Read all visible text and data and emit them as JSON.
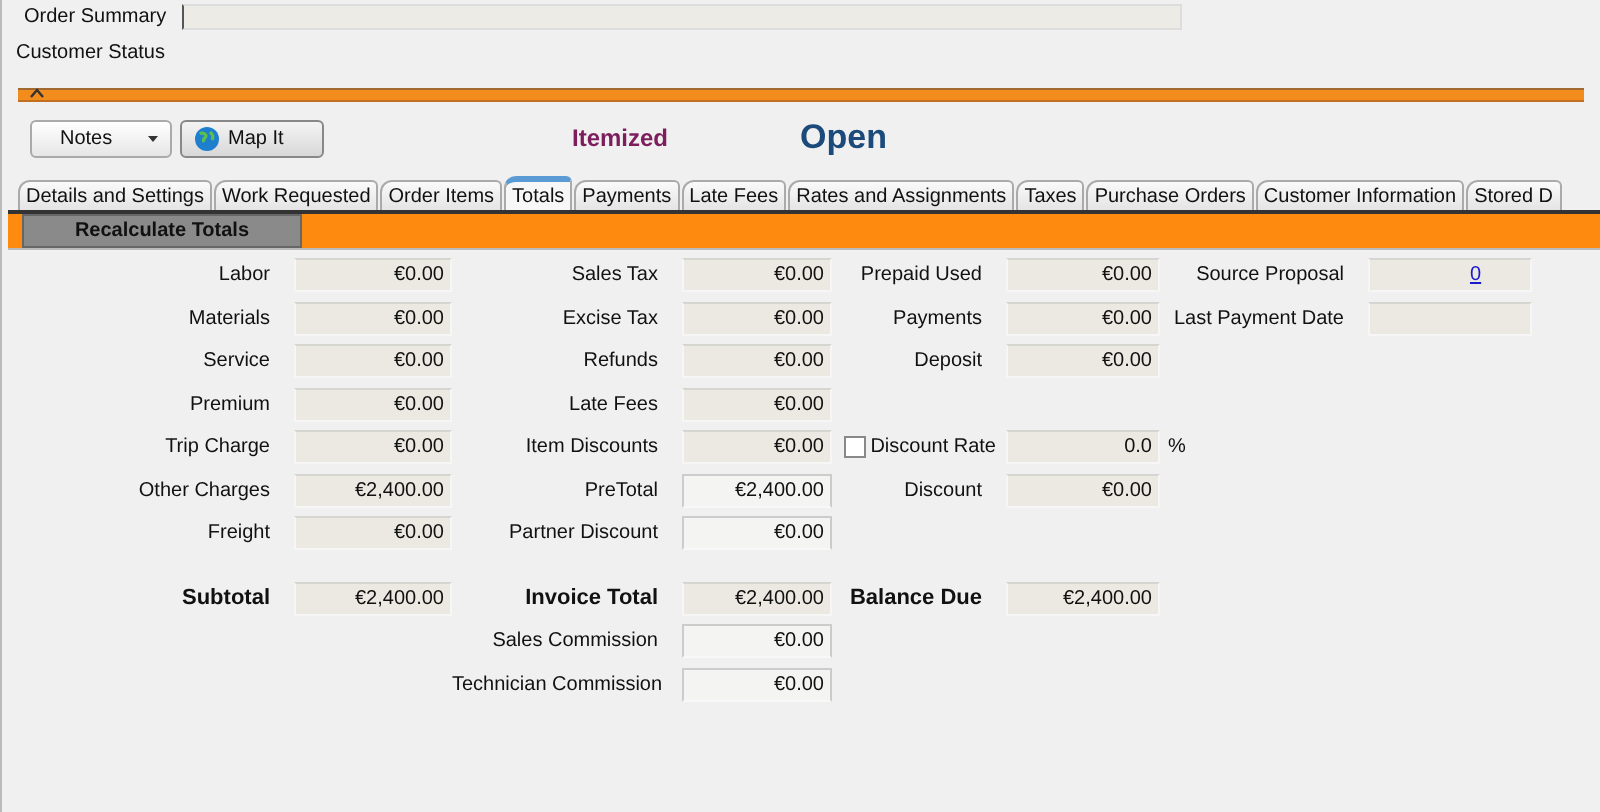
{
  "header": {
    "order_summary": {
      "label": "Order Summary"
    },
    "customer_status": {
      "label": "Customer Status"
    }
  },
  "toolbar": {
    "notes_button": "Notes",
    "map_button": "Map It",
    "billing_mode": "Itemized",
    "status": "Open"
  },
  "tabs": [
    {
      "label": "Details and Settings",
      "selected": false
    },
    {
      "label": "Work Requested",
      "selected": false
    },
    {
      "label": "Order Items",
      "selected": false
    },
    {
      "label": "Totals",
      "selected": true
    },
    {
      "label": "Payments",
      "selected": false
    },
    {
      "label": "Late Fees",
      "selected": false
    },
    {
      "label": "Rates and Assignments",
      "selected": false
    },
    {
      "label": "Taxes",
      "selected": false
    },
    {
      "label": "Purchase Orders",
      "selected": false
    },
    {
      "label": "Customer Information",
      "selected": false
    },
    {
      "label": "Stored D",
      "selected": false
    }
  ],
  "recalculate_button": "Recalculate Totals",
  "columns": [
    [
      {
        "label": "Labor",
        "value": "€0.00",
        "kind": "readonly"
      },
      {
        "label": "Materials",
        "value": "€0.00",
        "kind": "readonly"
      },
      {
        "label": "Service",
        "value": "€0.00",
        "kind": "readonly"
      },
      {
        "label": "Premium",
        "value": "€0.00",
        "kind": "readonly"
      },
      {
        "label": "Trip Charge",
        "value": "€0.00",
        "kind": "readonly"
      },
      {
        "label": "Other Charges",
        "value": "€2,400.00",
        "kind": "readonly"
      },
      {
        "label": "Freight",
        "value": "€0.00",
        "kind": "readonly"
      },
      {
        "label": "Subtotal",
        "value": "€2,400.00",
        "kind": "total"
      }
    ],
    [
      {
        "label": "Sales Tax",
        "value": "€0.00",
        "kind": "readonly"
      },
      {
        "label": "Excise Tax",
        "value": "€0.00",
        "kind": "readonly"
      },
      {
        "label": "Refunds",
        "value": "€0.00",
        "kind": "readonly"
      },
      {
        "label": "Late Fees",
        "value": "€0.00",
        "kind": "readonly"
      },
      {
        "label": "Item Discounts",
        "value": "€0.00",
        "kind": "readonly"
      },
      {
        "label": "PreTotal",
        "value": "€2,400.00",
        "kind": "editable"
      },
      {
        "label": "Partner Discount",
        "value": "€0.00",
        "kind": "editable"
      },
      {
        "label": "Invoice Total",
        "value": "€2,400.00",
        "kind": "total"
      },
      {
        "label": "Sales Commission",
        "value": "€0.00",
        "kind": "editable"
      },
      {
        "label": "Technician Commission",
        "value": "€0.00",
        "kind": "editable"
      }
    ],
    [
      {
        "label": "Prepaid Used",
        "value": "€0.00",
        "kind": "readonly"
      },
      {
        "label": "Payments",
        "value": "€0.00",
        "kind": "readonly"
      },
      {
        "label": "Deposit",
        "value": "€0.00",
        "kind": "readonly"
      },
      {
        "label": "Discount Rate",
        "value": "0.0",
        "unit": "%",
        "kind": "checkbox",
        "checked": false
      },
      {
        "label": "Discount",
        "value": "€0.00",
        "kind": "readonly"
      },
      {
        "label": "Balance Due",
        "value": "€2,400.00",
        "kind": "total"
      }
    ],
    [
      {
        "label": "Source Proposal",
        "value": "0",
        "kind": "link"
      },
      {
        "label": "Last Payment Date",
        "kind": "readonly"
      }
    ]
  ]
}
